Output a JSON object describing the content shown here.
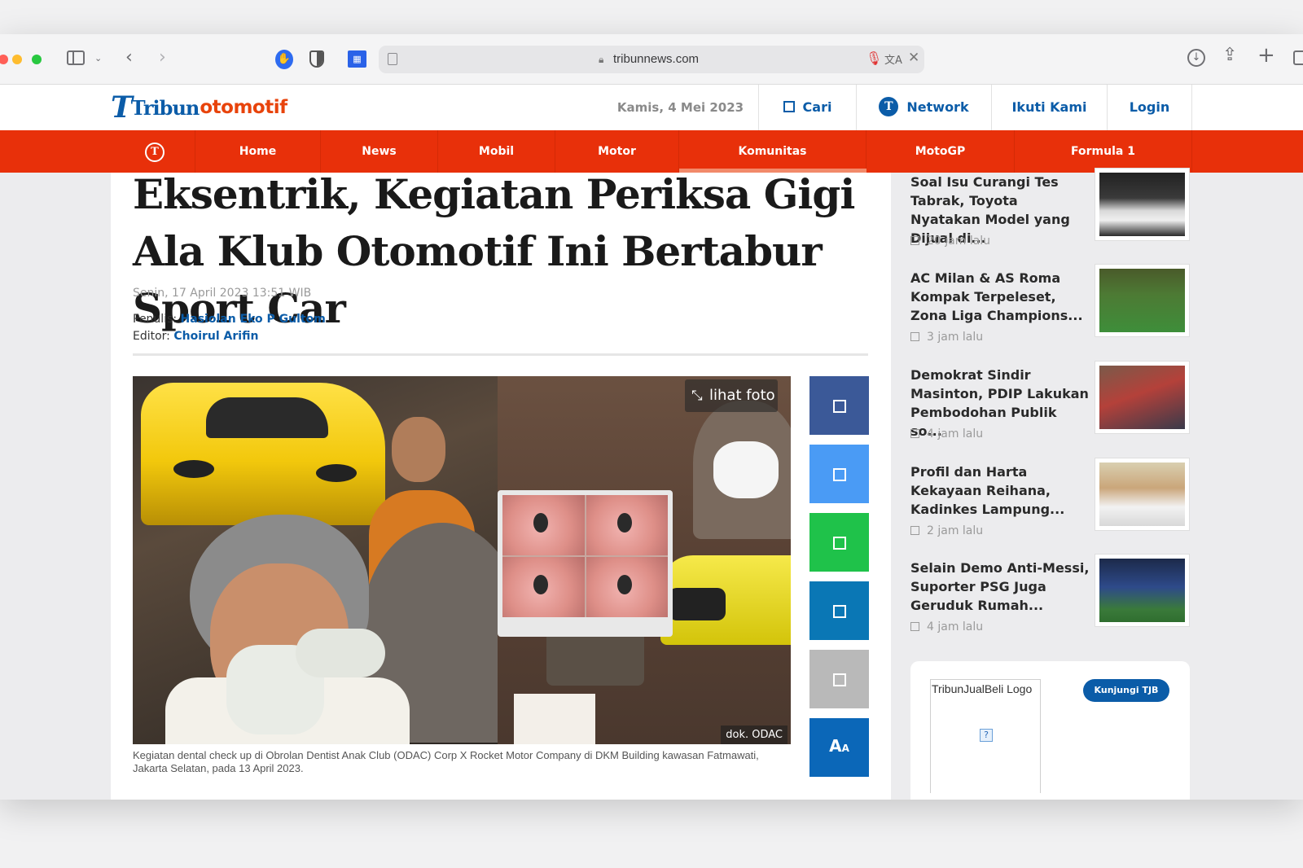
{
  "browser": {
    "url": "tribunnews.com"
  },
  "site": {
    "logo_word_1": "Tribun",
    "logo_word_2": "otomotif",
    "logo_mark": "T",
    "header": {
      "date": "Kamis, 4 Mei 2023",
      "search_label": "Cari",
      "network_label": "Network",
      "follow_label": "Ikuti Kami",
      "login_label": "Login"
    },
    "nav": [
      "Home",
      "News",
      "Mobil",
      "Motor",
      "Komunitas",
      "MotoGP",
      "Formula 1"
    ],
    "nav_active": "Komunitas"
  },
  "article": {
    "headline": "Eksentrik, Kegiatan Periksa Gigi Ala Klub Otomotif Ini Bertabur Sport Car",
    "date": "Senin, 17 April 2023 13:51 WIB",
    "author_label": "Penulis:",
    "author": "Hasiolan Eko P Gultom",
    "editor_label": "Editor:",
    "editor": "Choirul Arifin",
    "photo_button": "lihat foto",
    "photo_credit": "dok. ODAC",
    "caption": "Kegiatan dental check up di Obrolan Dentist Anak Club (ODAC) Corp X Rocket Motor Company di DKM Building kawasan Fatmawati, Jakarta Selatan, pada 13 April 2023.",
    "share_buttons": [
      {
        "name": "facebook",
        "color": "#3b5998"
      },
      {
        "name": "twitter",
        "color": "#4a9bf5"
      },
      {
        "name": "whatsapp",
        "color": "#1fc24a"
      },
      {
        "name": "linkedin",
        "color": "#0a77b5"
      },
      {
        "name": "copy-link",
        "color": "#b9b9b9"
      }
    ],
    "font_size_label": "A",
    "font_size_sub": "A",
    "font_size_color": "#0b67b8"
  },
  "sidebar": {
    "items": [
      {
        "title": "Soal Isu Curangi Tes Tabrak, Toyota Nyatakan Model yang Dijual di...",
        "time": "20 jam lalu"
      },
      {
        "title": "AC Milan & AS Roma Kompak Terpeleset, Zona Liga Champions...",
        "time": "3 jam lalu"
      },
      {
        "title": "Demokrat Sindir Masinton, PDIP Lakukan Pembodohan Publik so...",
        "time": "4 jam lalu"
      },
      {
        "title": "Profil dan Harta Kekayaan Reihana, Kadinkes Lampung...",
        "time": "2 jam lalu"
      },
      {
        "title": "Selain Demo Anti-Messi, Suporter PSG Juga Geruduk Rumah...",
        "time": "4 jam lalu"
      }
    ],
    "tjb": {
      "logo_alt": "TribunJualBeli Logo",
      "broken_glyph": "?",
      "button": "Kunjungi TJB"
    }
  },
  "colors": {
    "brand_blue": "#0b5ca8",
    "nav_red": "#e8300a",
    "brand_orange": "#e8430b"
  }
}
